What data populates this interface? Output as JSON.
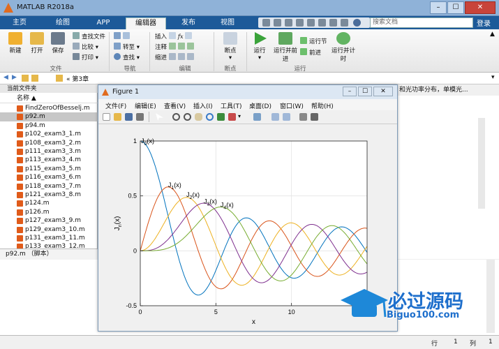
{
  "app": {
    "title": "MATLAB R2018a",
    "search_placeholder": "搜索文档",
    "login": "登录"
  },
  "ribbon_tabs": [
    "主页",
    "绘图",
    "APP",
    "编辑器",
    "发布",
    "视图"
  ],
  "ribbon": {
    "file": {
      "new": "新建",
      "open": "打开",
      "save": "保存",
      "find_files": "查找文件",
      "compare": "比较",
      "print": "打印",
      "label": "文件"
    },
    "nav": {
      "goto": "转至",
      "find": "查找",
      "label": "导航"
    },
    "edit": {
      "insert": "插入",
      "comment": "注释",
      "indent": "缩进",
      "fx": "fx",
      "label": "编辑"
    },
    "breakpoints": {
      "bp": "断点",
      "label": "断点"
    },
    "run": {
      "run": "运行",
      "run_advance": "运行并前进",
      "run_section": "运行节",
      "advance": "前进",
      "run_time": "运行并计时",
      "label": "运行"
    }
  },
  "address": {
    "path": "« 第3章"
  },
  "file_panel": {
    "title": "当前文件夹",
    "header": "名称 ▲",
    "files": [
      "FindZeroOfBesselj.m",
      "p92.m",
      "p94.m",
      "p102_exam3_1.m",
      "p108_exam3_2.m",
      "p111_exam3_3.m",
      "p113_exam3_4.m",
      "p115_exam3_5.m",
      "p116_exam3_6.m",
      "p118_exam3_7.m",
      "p121_exam3_8.m",
      "p124.m",
      "p126.m",
      "p127_exam3_9.m",
      "p129_exam3_10.m",
      "p131_exam3_11.m",
      "p133_exam3_12.m"
    ],
    "selected_index": 1,
    "details": "p92.m （脚本）"
  },
  "right_panel": {
    "header": "和光功率分布，单模光..."
  },
  "status": {
    "row_label": "行",
    "row": "1",
    "col_label": "列",
    "col": "1"
  },
  "figure": {
    "title": "Figure 1",
    "menus": [
      "文件(F)",
      "编辑(E)",
      "查看(V)",
      "插入(I)",
      "工具(T)",
      "桌面(D)",
      "窗口(W)",
      "帮助(H)"
    ]
  },
  "watermark": {
    "text": "必过源码",
    "url": "Biguo100.com"
  },
  "colors": {
    "series": [
      "#0072bd",
      "#d95319",
      "#edb120",
      "#7e2f8e",
      "#77ac30"
    ]
  },
  "chart_data": {
    "type": "line",
    "xlabel": "x",
    "ylabel": "J_n(x)",
    "xlim": [
      0,
      15
    ],
    "ylim": [
      -0.5,
      1
    ],
    "xticks": [
      0,
      5,
      10
    ],
    "yticks": [
      -0.5,
      0,
      0.5,
      1
    ],
    "grid": true,
    "series": [
      {
        "order": 0,
        "x_step": 0.1
      },
      {
        "order": 1,
        "x_step": 0.1
      },
      {
        "order": 2,
        "x_step": 0.1
      },
      {
        "order": 3,
        "x_step": 0.1
      },
      {
        "order": 4,
        "x_step": 0.1
      }
    ],
    "annotations": [
      {
        "text": "J",
        "sub": "0",
        "rest": "(x)",
        "x": 0.05,
        "y": 0.98
      },
      {
        "text": "J",
        "sub": "1",
        "rest": "(x)",
        "x": 1.84,
        "y": 0.58
      },
      {
        "text": "J",
        "sub": "2",
        "rest": "(x)",
        "x": 3.05,
        "y": 0.49
      },
      {
        "text": "J",
        "sub": "3",
        "rest": "(x)",
        "x": 4.2,
        "y": 0.43
      },
      {
        "text": "J",
        "sub": "4",
        "rest": "(x)",
        "x": 5.3,
        "y": 0.4
      }
    ]
  }
}
